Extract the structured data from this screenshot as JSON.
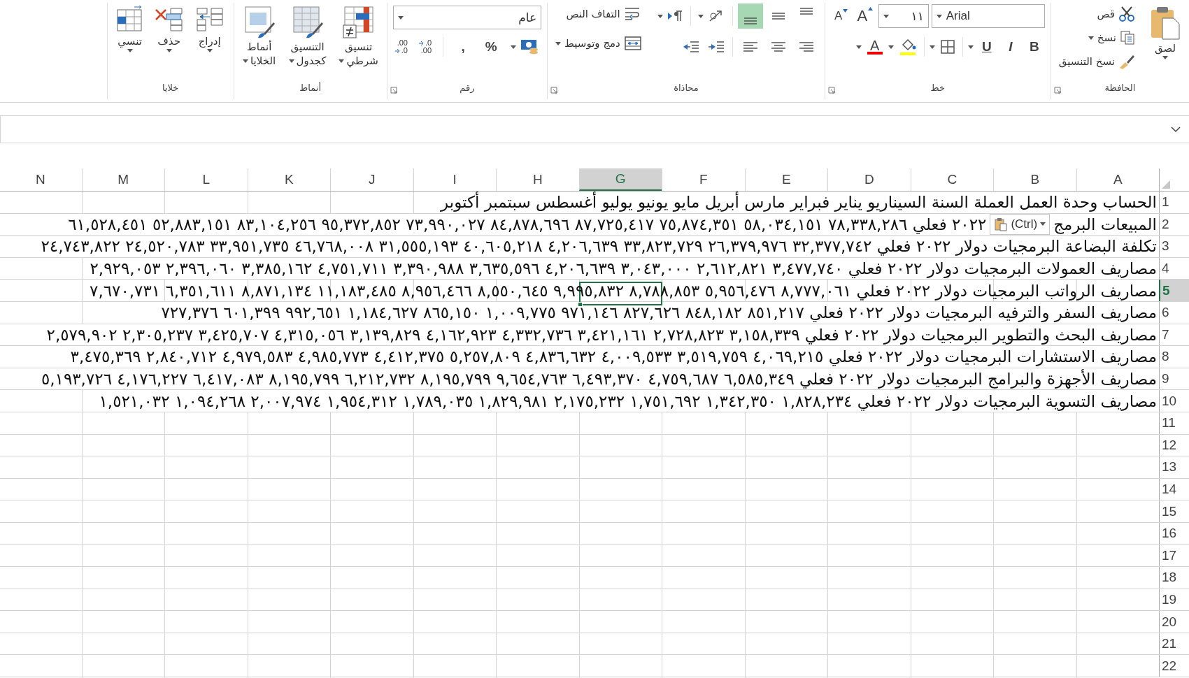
{
  "ribbon": {
    "groups": [
      {
        "kind": "clipboard",
        "label": "الحافظة",
        "launcher": true,
        "paste": {
          "label": "لصق"
        },
        "items": [
          {
            "label": "قص",
            "caret": false
          },
          {
            "label": "نسخ",
            "caret": true
          },
          {
            "label": "نسخ التنسيق",
            "caret": false
          }
        ]
      },
      {
        "kind": "font",
        "label": "خط",
        "launcher": true,
        "font": "Arial",
        "size": "١١",
        "grow": "A",
        "shrink": "A",
        "styles": [
          "B",
          "I",
          "U"
        ],
        "font_color": "A"
      },
      {
        "kind": "alignment",
        "label": "محاذاة",
        "launcher": true,
        "vertical": [
          {
            "selected": false
          },
          {
            "selected": false
          },
          {
            "selected": true
          }
        ],
        "wrap": "التفاف النص",
        "merge": "دمج وتوسيط"
      },
      {
        "kind": "number",
        "label": "رقم",
        "launcher": true,
        "format": "عام",
        "percent": "%",
        "comma": ",",
        "increase": [
          ".0",
          ".00"
        ],
        "decrease": [
          ".00",
          ".0"
        ]
      },
      {
        "kind": "styles",
        "label": "أنماط",
        "launcher": false,
        "items": [
          {
            "lines": [
              "تنسيق",
              "شرطي"
            ]
          },
          {
            "lines": [
              "التنسيق",
              "كجدول"
            ]
          },
          {
            "lines": [
              "أنماط",
              "الخلايا"
            ]
          }
        ]
      },
      {
        "kind": "cells",
        "label": "خلايا",
        "launcher": false,
        "items": [
          {
            "label": "إدراج"
          },
          {
            "label": "حذف"
          },
          {
            "label": "تنسي"
          }
        ]
      }
    ]
  },
  "sheet": {
    "columns": [
      {
        "label": "A",
        "selected": false
      },
      {
        "label": "B",
        "selected": false
      },
      {
        "label": "C",
        "selected": false
      },
      {
        "label": "D",
        "selected": false
      },
      {
        "label": "E",
        "selected": false
      },
      {
        "label": "F",
        "selected": false
      },
      {
        "label": "G",
        "selected": true
      },
      {
        "label": "H",
        "selected": false
      },
      {
        "label": "I",
        "selected": false
      },
      {
        "label": "J",
        "selected": false
      },
      {
        "label": "K",
        "selected": false
      },
      {
        "label": "L",
        "selected": false
      },
      {
        "label": "M",
        "selected": false
      },
      {
        "label": "N",
        "selected": false
      }
    ],
    "rows": [
      {
        "number": "1",
        "selected": false,
        "text": "الحساب وحدة العمل العملة السنة السيناريو يناير فبراير مارس أبريل مايو يونيو يوليو أغسطس سبتمبر أكتوبر"
      },
      {
        "number": "2",
        "selected": false,
        "text": "المبيعات البرمج",
        "paste_options": {
          "label": "(Ctrl)"
        },
        "text_after": "٢٠٢٢ فعلي ٧٨,٣٣٨,٢٨٦ ٥٨,٠٣٤,١٥١ ٧٥,٨٧٤,٣٥١ ٨٧,٧٢٥,٤١٧ ٨٤,٨٧٨,٦٩٦ ٧٣,٩٩٠,٠٢٧ ٩٥,٣٧٢,٨٥٢ ٨٣,١٠٤,٢٥٦ ٥٢,٨٨٣,١٥١ ٦١,٥٢٨,٤٥١"
      },
      {
        "number": "3",
        "selected": false,
        "text": "تكلفة البضاعة البرمجيات دولار ٢٠٢٢ فعلي ٣٢,٣٧٧,٧٤٢ ٢٦,٣٧٩,٩٧٦ ٣٣,٨٢٣,٧٢٩ ٤,٢٠٦,٦٣٩ ٤٠,٦٠٥,٢١٨ ٣١,٥٥٥,١٩٣ ٤٦,٧٦٨,٠٠٨ ٣٣,٩٥١,٧٣٥ ٢٤,٥٢٠,٧٨٣ ٢٤,٧٤٣,٨٢٢"
      },
      {
        "number": "4",
        "selected": false,
        "text": "مصاريف العمولات البرمجيات دولار ٢٠٢٢ فعلي ٣,٤٧٧,٧٤٠ ٢,٦١٢,٨٢١ ٣,٠٤٣,٠٠٠ ٤,٢٠٦,٦٣٩ ٣,٦٣٥,٥٩٦ ٣,٣٩٠,٩٨٨ ٤,٧٥١,٧١١ ٣,٣٨٥,١٦٢ ٢,٣٩٦,٠٦٠ ٢,٩٢٩,٠٥٣"
      },
      {
        "number": "5",
        "selected": true,
        "text": "مصاريف الرواتب البرمجيات دولار ٢٠٢٢ فعلي ٨,٧٧٧,٠٦١ ٥,٩٥٦,٤٧٦ ٨,٧٨٨,٨٥٣ ٩,٩٩٥,٨٣٢ ٨,٥٥٠,٦٤٥ ٨,٩٥٦,٤٦٦ ١١,١٨٣,٤٨٥ ٨,٨٧١,١٣٤ ٦,٣٥١,٦١١ ٧,٦٧٠,٧٣١"
      },
      {
        "number": "6",
        "selected": false,
        "text": "مصاريف السفر والترفيه البرمجيات دولار ٢٠٢٢ فعلي ٨٥١,٢١٧ ٨٤٨,١٨٢ ٨٢٧,٦٢٦ ٩٧١,١٤٦ ١,٠٠٩,٧٧٥ ٨٦٥,١٥٠ ١,١٨٤,٦٢٧ ٩٩٢,٦٥١ ٦٠١,٣٩٩ ٧٢٧,٣٧٦"
      },
      {
        "number": "7",
        "selected": false,
        "text": "مصاريف البحث والتطوير البرمجيات دولار ٢٠٢٢ فعلي ٣,١٥٨,٣٣٩ ٢,٧٢٨,٨٢٣ ٣,٤٢١,١٦١ ٤,٣٣٢,٧٣٦ ٤,١٦٢,٩٢٣ ٣,١٣٩,٨٢٩ ٤,٣١٥,٠٥٦ ٣,٤٢٥,٧٠٧ ٢,٣٠٥,٢٣٧ ٢,٥٧٩,٩٠٢"
      },
      {
        "number": "8",
        "selected": false,
        "text": "مصاريف الاستشارات البرمجيات دولار ٢٠٢٢ فعلي ٤,٠٦٩,٢١٥ ٣,٥١٩,٧٥٩ ٤,٠٠٩,٥٣٣ ٤,٨٣٦,٦٣٢ ٥,٢٥٧,٨٠٩ ٤,٤١٢,٣٧٥ ٤,٩٨٥,٧٧٣ ٤,٩٧٩,٥٨٣ ٢,٨٤٠,٧١٢ ٣,٤٧٥,٣٦٩"
      },
      {
        "number": "9",
        "selected": false,
        "text": "مصاريف الأجهزة والبرامج البرمجيات دولار ٢٠٢٢ فعلي ٦,٥٨٥,٣٤٩ ٤,٧٥٩,٦٨٧ ٦,٤٩٣,٣٧٠ ٩,٦٥٤,٧٦٣ ٨,١٩٥,٧٩٩ ٦,٢١٢,٧٣٢ ٨,١٩٥,٧٩٩ ٦,٤١٧,٠٨٣ ٤,١٧٦,٢٢٧ ٥,١٩٣,٧٢٦"
      },
      {
        "number": "10",
        "selected": false,
        "text": "مصاريف التسوية البرمجيات دولار ٢٠٢٢ فعلي ١,٨٢٨,٢٣٤ ١,٣٤٢,٣٥٠ ١,٧٥١,٦٩٢ ٢,١٧٥,٢٣٢ ١,٨٢٩,٩٨١ ١,٧٨٩,٠٣٥ ١,٩٥٤,٣١٢ ٢,٠٠٧,٩٧٤ ١,٠٩٤,٢٦٨ ١,٥٢١,٠٣٢"
      },
      {
        "number": "11",
        "selected": false
      },
      {
        "number": "12",
        "selected": false
      },
      {
        "number": "13",
        "selected": false
      },
      {
        "number": "14",
        "selected": false
      },
      {
        "number": "15",
        "selected": false
      },
      {
        "number": "16",
        "selected": false
      },
      {
        "number": "17",
        "selected": false
      },
      {
        "number": "18",
        "selected": false
      },
      {
        "number": "19",
        "selected": false
      },
      {
        "number": "20",
        "selected": false
      },
      {
        "number": "21",
        "selected": false
      },
      {
        "number": "22",
        "selected": false
      }
    ]
  }
}
